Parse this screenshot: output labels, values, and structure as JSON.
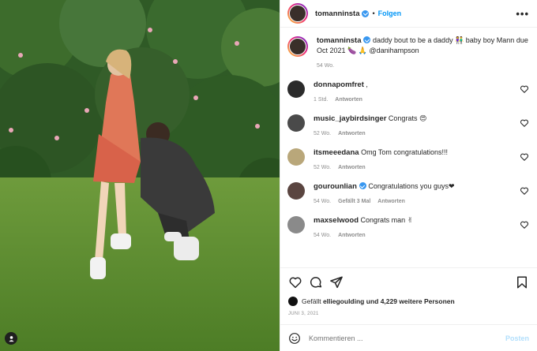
{
  "post": {
    "username": "tomanninsta",
    "follow_label": "Folgen",
    "separator": "•",
    "more_label": "•••",
    "caption_text": " daddy bout to be a daddy 👫 baby boy Mann due Oct 2021 🍆 🙏 @danihampson",
    "caption_time": "54 Wo."
  },
  "comments": [
    {
      "user": "donnapomfret",
      "verified": false,
      "text": ",",
      "time": "1 Std.",
      "likes": "",
      "reply": "Antworten",
      "avatar_color": "#2b2b2b"
    },
    {
      "user": "music_jaybirdsinger",
      "verified": false,
      "text": "Congrats 😍",
      "time": "52 Wo.",
      "likes": "",
      "reply": "Antworten",
      "avatar_color": "#4a4a4a"
    },
    {
      "user": "itsmeeedana",
      "verified": false,
      "text": "Omg Tom congratulations!!!",
      "time": "52 Wo.",
      "likes": "",
      "reply": "Antworten",
      "avatar_color": "#b9a77a"
    },
    {
      "user": "gourounlian",
      "verified": true,
      "text": "Congratulations you guys❤",
      "time": "54 Wo.",
      "likes": "Gefällt 3 Mal",
      "reply": "Antworten",
      "avatar_color": "#5a4540"
    },
    {
      "user": "maxselwood",
      "verified": false,
      "text": "Congrats man ✌",
      "time": "54 Wo.",
      "likes": "",
      "reply": "Antworten",
      "avatar_color": "#8a8a8a"
    }
  ],
  "likes": {
    "prefix": "Gefällt",
    "user": "elliegoulding",
    "suffix": "und 4,229 weitere Personen"
  },
  "date": "JUNI 3, 2021",
  "composer": {
    "placeholder": "Kommentieren ...",
    "post_label": "Posten"
  },
  "colors": {
    "accent": "#0095f6",
    "verified": "#3897f0",
    "muted": "#8e8e8e",
    "post_disabled": "#b2dffc"
  },
  "icons": {
    "like": "heart-icon",
    "comment": "comment-icon",
    "share": "share-icon",
    "save": "bookmark-icon",
    "emoji": "emoji-icon",
    "tags": "user-tag-icon"
  }
}
